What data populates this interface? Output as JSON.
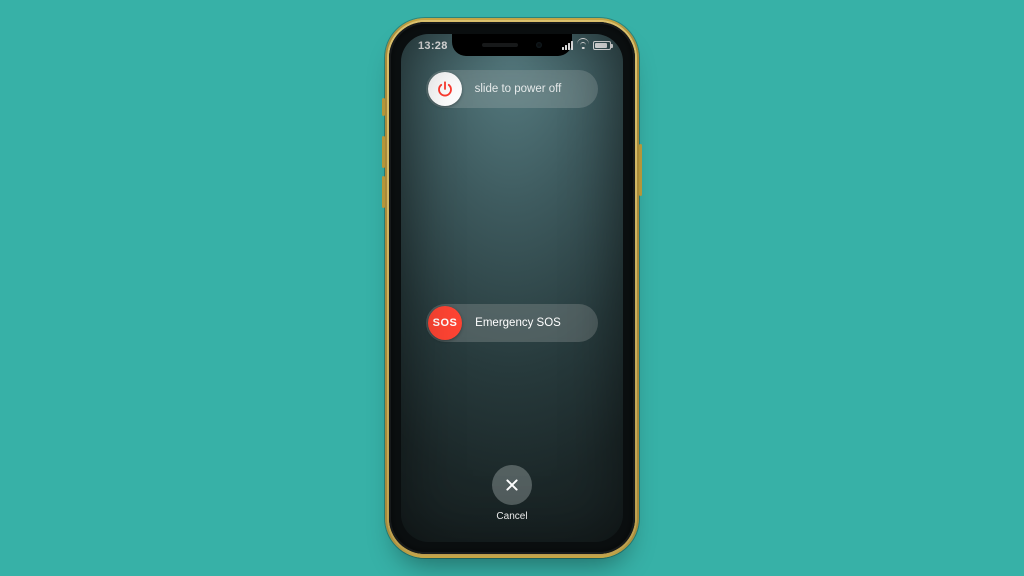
{
  "status": {
    "time": "13:28"
  },
  "powerSlider": {
    "label": "slide to power off",
    "icon_name": "power-icon"
  },
  "sosSlider": {
    "label": "Emergency SOS",
    "knob_text": "SOS"
  },
  "cancel": {
    "label": "Cancel",
    "icon_name": "close-icon"
  }
}
